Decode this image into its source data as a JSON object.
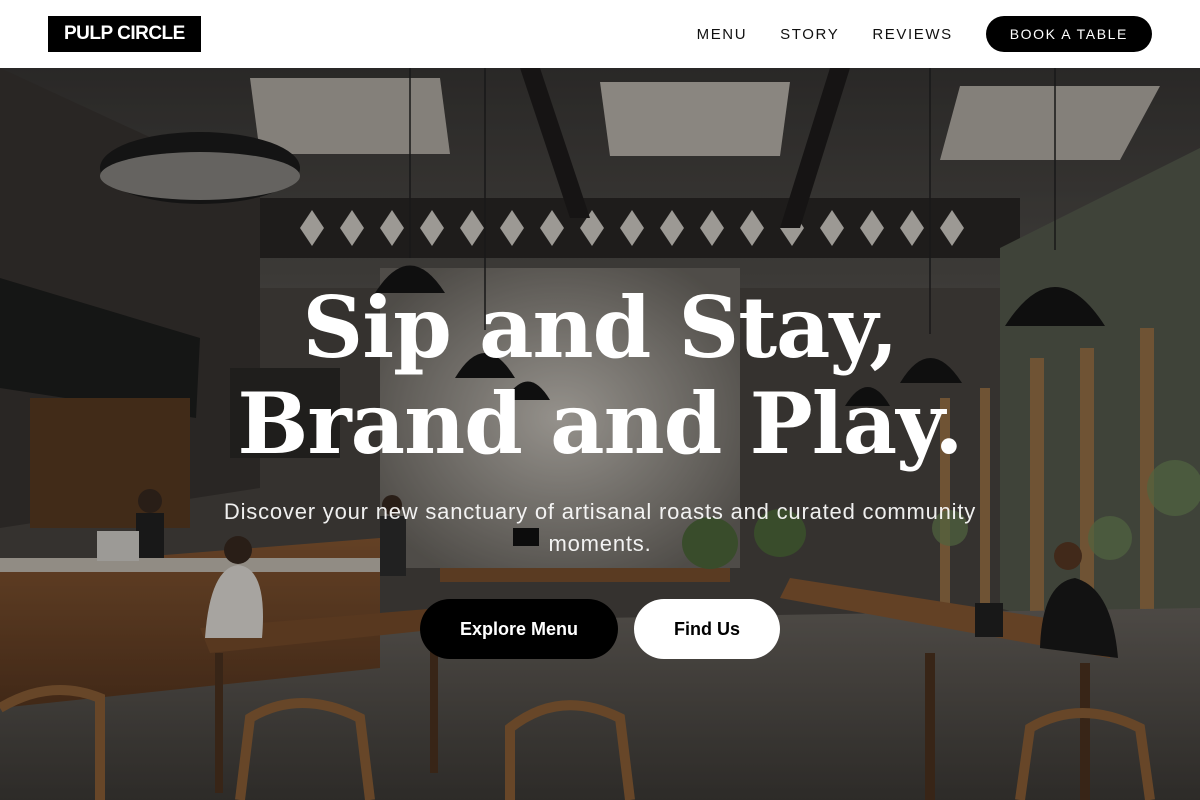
{
  "brand": {
    "logo_text": "PULP CIRCLE"
  },
  "nav": {
    "items": [
      {
        "label": "MENU"
      },
      {
        "label": "STORY"
      },
      {
        "label": "REVIEWS"
      }
    ],
    "cta_label": "BOOK A TABLE"
  },
  "hero": {
    "title_line1": "Sip and Stay,",
    "title_line2": "Brand and Play.",
    "subtitle": "Discover your new sanctuary of artisanal roasts and curated community moments.",
    "primary_button": "Explore Menu",
    "secondary_button": "Find Us"
  },
  "colors": {
    "nav_background": "#ffffff",
    "logo_background": "#000000",
    "primary_button": "#000000",
    "secondary_button": "#ffffff",
    "hero_text": "#ffffff"
  }
}
